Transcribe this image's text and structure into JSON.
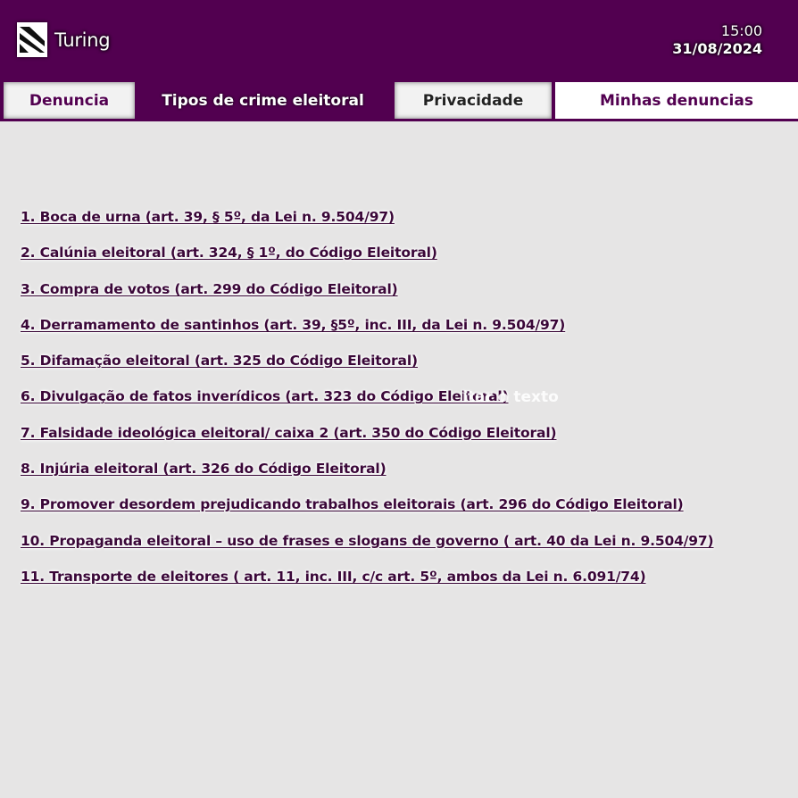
{
  "header": {
    "brand": "Turing",
    "time": "15:00",
    "date": "31/08/2024",
    "logo_icon": "turing-logo-icon"
  },
  "tabs": [
    {
      "label": "Denuncia",
      "active": false
    },
    {
      "label": "Tipos de crime eleitoral",
      "active": true
    },
    {
      "label": "Privacidade",
      "active": false
    },
    {
      "label": "Minhas denuncias",
      "active": false
    }
  ],
  "crimes": [
    "1. Boca de urna (art. 39, § 5º, da Lei n. 9.504/97)",
    "2. Calúnia eleitoral (art. 324, § 1º, do Código Eleitoral)",
    "3. Compra de votos (art. 299 do Código Eleitoral)",
    "4. Derramamento de santinhos (art. 39, §5º, inc. III, da Lei n. 9.504/97)",
    "5. Difamação eleitoral (art. 325 do Código Eleitoral)",
    "6. Divulgação de fatos inverídicos (art. 323 do Código Eleitoral)",
    "7. Falsidade ideológica eleitoral/ caixa 2 (art. 350 do Código Eleitoral)",
    "8. Injúria eleitoral (art. 326 do Código Eleitoral)",
    "9. Promover desordem prejudicando trabalhos eleitorais (art. 296 do Código Eleitoral)",
    "10. Propaganda eleitoral – uso de frases e slogans de governo ( art. 40 da Lei n. 9.504/97)",
    "11. Transporte de eleitores ( art. 11, inc. III, c/c art. 5º, ambos da Lei n. 6.091/74)"
  ],
  "overlay_text": "itar o texto",
  "colors": {
    "brand_purple": "#520050",
    "background": "#e6e5e5",
    "link_text": "#3a0738"
  }
}
